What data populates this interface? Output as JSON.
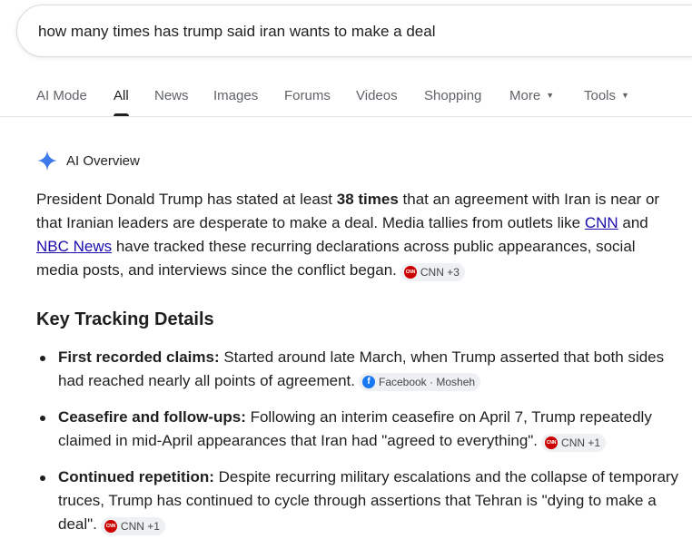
{
  "search": {
    "query": "how many times has trump said iran wants to make a deal"
  },
  "tabs": [
    {
      "label": "AI Mode"
    },
    {
      "label": "All"
    },
    {
      "label": "News"
    },
    {
      "label": "Images"
    },
    {
      "label": "Forums"
    },
    {
      "label": "Videos"
    },
    {
      "label": "Shopping"
    },
    {
      "label": "More"
    },
    {
      "label": "Tools"
    }
  ],
  "ai_overview": {
    "label": "AI Overview",
    "icon": "sparkle-icon",
    "accent_color": "#4285f4",
    "para": {
      "t1": "President Donald Trump has stated at least ",
      "bold": "38 times",
      "t2": " that an agreement with Iran is near or that Iranian leaders are desperate to make a deal. Media tallies from outlets like ",
      "link1": "CNN",
      "t3": " and ",
      "link2": "NBC News",
      "t4": " have tracked these recurring declarations across public appearances, social media posts, and interviews since the conflict began.",
      "source_chip": "CNN +3"
    }
  },
  "key_details": {
    "heading": "Key Tracking Details",
    "items": [
      {
        "bold": "First recorded claims:",
        "text": " Started around late March, when Trump asserted that both sides had reached nearly all points of agreement.",
        "chip": "Facebook · Mosheh",
        "chip_icon": "facebook-icon"
      },
      {
        "bold": "Ceasefire and follow-ups:",
        "text": " Following an interim ceasefire on April 7, Trump repeatedly claimed in mid-April appearances that Iran had \"agreed to everything\".",
        "chip": "CNN +1",
        "chip_icon": "cnn-icon"
      },
      {
        "bold": "Continued repetition:",
        "text": " Despite recurring military escalations and the collapse of temporary truces, Trump has continued to cycle through assertions that Tehran is \"dying to make a deal\".",
        "chip": "CNN +1",
        "chip_icon": "cnn-icon"
      }
    ]
  },
  "colors": {
    "link": "#1a0dab",
    "cnn_red": "#cc0000",
    "facebook_blue": "#1877f2"
  }
}
